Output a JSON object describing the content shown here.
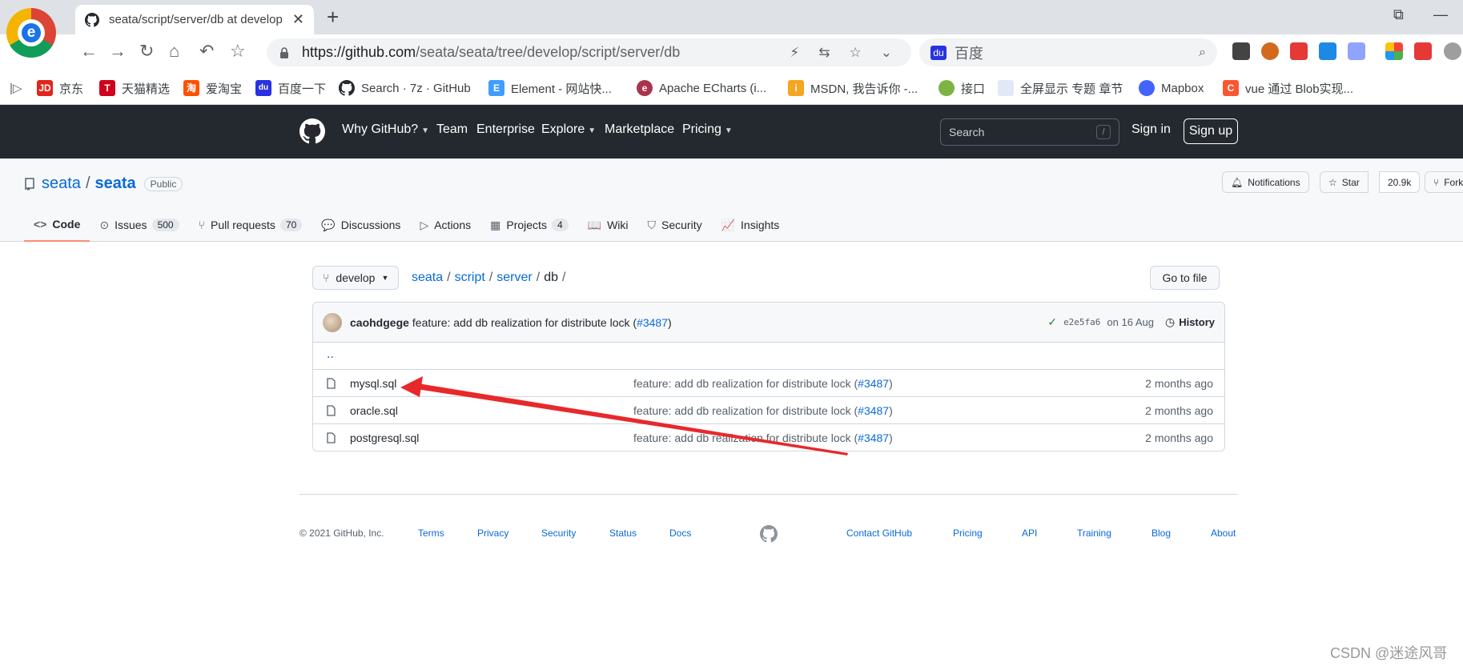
{
  "browser": {
    "tab_title": "seata/script/server/db at develop",
    "new_tab": "+",
    "tab_close": "✕",
    "url_prefix": "https://github.com",
    "url_path": "/seata/seata/tree/develop/script/server/db",
    "search_placeholder": "百度",
    "win_restore": "⧉",
    "win_minimize": "—"
  },
  "bookmarks": [
    {
      "label": "京东",
      "icon_text": "JD",
      "color": "#e1251b"
    },
    {
      "label": "天猫精选",
      "icon_text": "T",
      "color": "#d0021b"
    },
    {
      "label": "爱淘宝",
      "icon_text": "淘",
      "color": "#ff5000"
    },
    {
      "label": "百度一下",
      "icon_text": "du",
      "color": "#2932e1"
    },
    {
      "label": "Search · 7z · GitHub",
      "icon_text": "",
      "color": "#24292f"
    },
    {
      "label": "Element - 网站快...",
      "icon_text": "E",
      "color": "#409eff"
    },
    {
      "label": "Apache ECharts (i...",
      "icon_text": "e",
      "color": "#aa344d"
    },
    {
      "label": "MSDN, 我告诉你 -...",
      "icon_text": "i",
      "color": "#f5a623"
    },
    {
      "label": "接口",
      "icon_text": "",
      "color": "#7cb342"
    },
    {
      "label": "全屏显示 专题 章节",
      "icon_text": "",
      "color": "#e3e8f7"
    },
    {
      "label": "Mapbox",
      "icon_text": "",
      "color": "#4264fb"
    },
    {
      "label": "vue 通过 Blob实现...",
      "icon_text": "C",
      "color": "#fc5531"
    }
  ],
  "github_nav": {
    "items": [
      "Why GitHub?",
      "Team",
      "Enterprise",
      "Explore",
      "Marketplace",
      "Pricing"
    ],
    "search_placeholder": "Search",
    "search_shortcut": "/",
    "sign_in": "Sign in",
    "sign_up": "Sign up"
  },
  "repo": {
    "owner": "seata",
    "separator": "/",
    "name": "seata",
    "visibility": "Public",
    "notifications_label": "Notifications",
    "star_label": "Star",
    "star_count": "20.9k",
    "fork_label": "Fork",
    "tabs": [
      {
        "label": "Code",
        "count": "",
        "icon": "<>"
      },
      {
        "label": "Issues",
        "count": "500",
        "icon": "⊙"
      },
      {
        "label": "Pull requests",
        "count": "70",
        "icon": "⑂"
      },
      {
        "label": "Discussions",
        "count": "",
        "icon": "💬"
      },
      {
        "label": "Actions",
        "count": "",
        "icon": "▷"
      },
      {
        "label": "Projects",
        "count": "4",
        "icon": "▦"
      },
      {
        "label": "Wiki",
        "count": "",
        "icon": "📖"
      },
      {
        "label": "Security",
        "count": "",
        "icon": "⛉"
      },
      {
        "label": "Insights",
        "count": "",
        "icon": "📈"
      }
    ]
  },
  "browser_path": {
    "branch": "develop",
    "crumbs": [
      "seata",
      "script",
      "server",
      "db"
    ],
    "go_to_file": "Go to file"
  },
  "commit": {
    "author": "caohdgege",
    "message": "feature: add db realization for distribute lock (",
    "pr": "#3487",
    "message_end": ")",
    "check": "✓",
    "sha": "e2e5fa6",
    "date": "on 16 Aug",
    "history": "History"
  },
  "updir": "..",
  "files": [
    {
      "name": "mysql.sql",
      "msg": "feature: add db realization for distribute lock (",
      "pr": "#3487",
      "msg_end": ")",
      "age": "2 months ago"
    },
    {
      "name": "oracle.sql",
      "msg": "feature: add db realization for distribute lock (",
      "pr": "#3487",
      "msg_end": ")",
      "age": "2 months ago"
    },
    {
      "name": "postgresql.sql",
      "msg": "feature: add db realization for distribute lock (",
      "pr": "#3487",
      "msg_end": ")",
      "age": "2 months ago"
    }
  ],
  "footer": {
    "copyright": "© 2021 GitHub, Inc.",
    "links": [
      "Terms",
      "Privacy",
      "Security",
      "Status",
      "Docs",
      "Contact GitHub",
      "Pricing",
      "API",
      "Training",
      "Blog",
      "About"
    ]
  },
  "watermark": "CSDN @迷途风哥",
  "colors": {
    "github_header": "#24292f",
    "link": "#0969da",
    "annotation_arrow": "#e8282b"
  }
}
